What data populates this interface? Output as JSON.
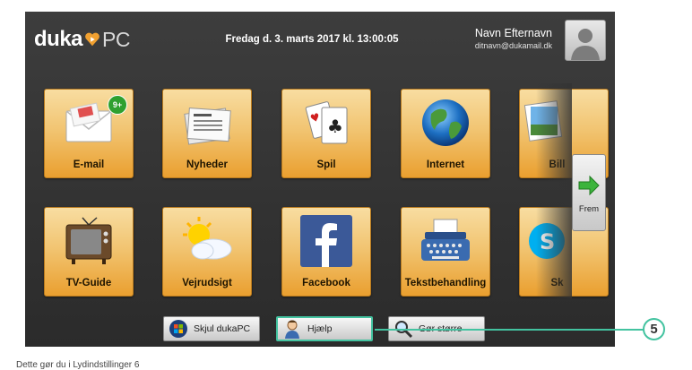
{
  "header": {
    "logo_text_1": "duka",
    "logo_text_2": "PC",
    "datetime": "Fredag d. 3. marts 2017 kl. 13:00:05",
    "user_name": "Navn Efternavn",
    "user_email": "ditnavn@dukamail.dk"
  },
  "tiles": [
    {
      "label": "E-mail",
      "icon": "envelope-icon",
      "badge": "9+"
    },
    {
      "label": "Nyheder",
      "icon": "newspaper-icon"
    },
    {
      "label": "Spil",
      "icon": "playing-cards-icon"
    },
    {
      "label": "Internet",
      "icon": "globe-icon"
    },
    {
      "label": "Bill",
      "icon": "photos-icon"
    },
    {
      "label": "TV-Guide",
      "icon": "television-icon"
    },
    {
      "label": "Vejrudsigt",
      "icon": "weather-icon"
    },
    {
      "label": "Facebook",
      "icon": "facebook-icon"
    },
    {
      "label": "Tekstbehandling",
      "icon": "typewriter-icon"
    },
    {
      "label": "Sk",
      "icon": "skype-icon"
    }
  ],
  "next": {
    "label": "Frem",
    "icon": "arrow-right-icon"
  },
  "bottom_buttons": [
    {
      "label": "Skjul dukaPC",
      "icon": "windows-icon"
    },
    {
      "label": "Hjælp",
      "icon": "help-person-icon"
    },
    {
      "label": "Gør større",
      "icon": "magnifier-icon"
    }
  ],
  "callout": {
    "number": "5"
  },
  "footer_text": "Dette gør du i Lydindstillinger 6",
  "colors": {
    "accent": "#43c3a0",
    "tile_top": "#f8dda1",
    "tile_bottom": "#ea9f2f",
    "background": "#333333"
  }
}
